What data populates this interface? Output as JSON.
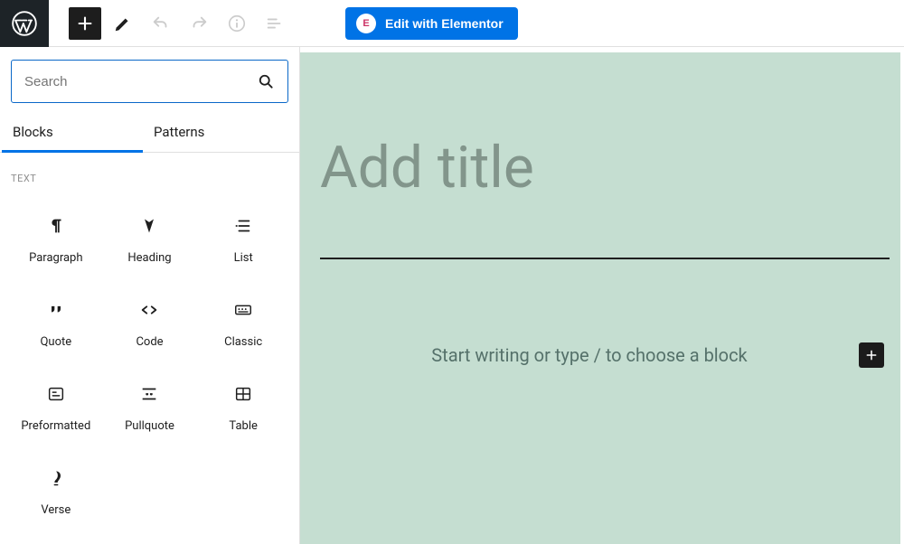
{
  "toolbar": {
    "elementor_label": "Edit with Elementor"
  },
  "inserter": {
    "search_placeholder": "Search",
    "tabs": [
      "Blocks",
      "Patterns"
    ],
    "category": "TEXT",
    "blocks": [
      {
        "label": "Paragraph",
        "icon": "paragraph"
      },
      {
        "label": "Heading",
        "icon": "heading"
      },
      {
        "label": "List",
        "icon": "list"
      },
      {
        "label": "Quote",
        "icon": "quote"
      },
      {
        "label": "Code",
        "icon": "code"
      },
      {
        "label": "Classic",
        "icon": "classic"
      },
      {
        "label": "Preformatted",
        "icon": "preformatted"
      },
      {
        "label": "Pullquote",
        "icon": "pullquote"
      },
      {
        "label": "Table",
        "icon": "table"
      },
      {
        "label": "Verse",
        "icon": "verse"
      }
    ]
  },
  "canvas": {
    "title_placeholder": "Add title",
    "content_placeholder": "Start writing or type / to choose a block"
  },
  "colors": {
    "accent": "#0073e6",
    "canvas_bg": "#c5ded1"
  }
}
